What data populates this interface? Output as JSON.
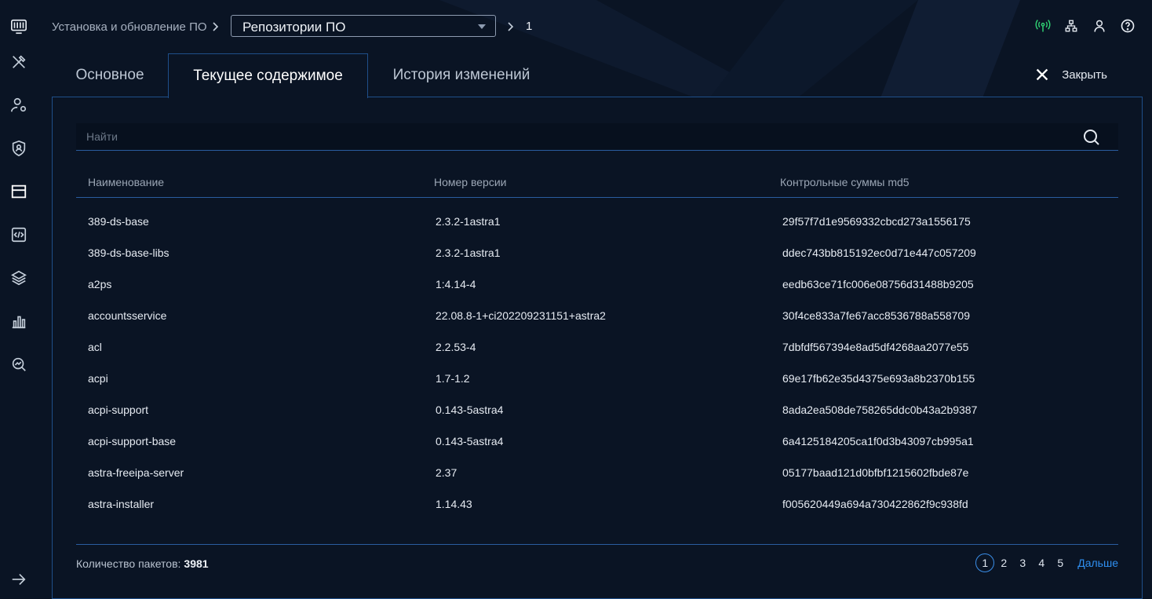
{
  "breadcrumb": {
    "root": "Установка и обновление ПО",
    "selected": "Репозитории ПО",
    "leaf": "1"
  },
  "tabs": [
    {
      "label": "Основное"
    },
    {
      "label": "Текущее содержимое"
    },
    {
      "label": "История изменений"
    }
  ],
  "active_tab": "Текущее содержимое",
  "close_label": "Закрыть",
  "search": {
    "placeholder": "Найти",
    "value": ""
  },
  "table": {
    "headers": [
      "Наименование",
      "Номер версии",
      "Контрольные суммы md5"
    ],
    "rows": [
      {
        "name": "389-ds-base",
        "version": "2.3.2-1astra1",
        "md5": "29f57f7d1e9569332cbcd273a1556175"
      },
      {
        "name": "389-ds-base-libs",
        "version": "2.3.2-1astra1",
        "md5": "ddec743bb815192ec0d71e447c057209"
      },
      {
        "name": "a2ps",
        "version": "1:4.14-4",
        "md5": "eedb63ce71fc006e08756d31488b9205"
      },
      {
        "name": "accountsservice",
        "version": "22.08.8-1+ci202209231151+astra2",
        "md5": "30f4ce833a7fe67acc8536788a558709"
      },
      {
        "name": "acl",
        "version": "2.2.53-4",
        "md5": "7dbfdf567394e8ad5df4268aa2077e55"
      },
      {
        "name": "acpi",
        "version": "1.7-1.2",
        "md5": "69e17fb62e35d4375e693a8b2370b155"
      },
      {
        "name": "acpi-support",
        "version": "0.143-5astra4",
        "md5": "8ada2ea508de758265ddc0b43a2b9387"
      },
      {
        "name": "acpi-support-base",
        "version": "0.143-5astra4",
        "md5": "6a4125184205ca1f0d3b43097cb995a1"
      },
      {
        "name": "astra-freeipa-server",
        "version": "2.37",
        "md5": "05177baad121d0bfbf1215602fbde87e"
      },
      {
        "name": "astra-installer",
        "version": "1.14.43",
        "md5": "f005620449a694a730422862f9c938fd"
      }
    ]
  },
  "footer": {
    "count_label": "Количество пакетов:",
    "count_value": "3981",
    "pages": [
      "1",
      "2",
      "3",
      "4",
      "5"
    ],
    "current_page": "1",
    "next_label": "Дальше"
  },
  "colors": {
    "background": "#0a1424",
    "border_accent": "#1f4f8a",
    "link": "#2f8ff0",
    "status_online": "#2ecc71"
  },
  "icons": {
    "sidebar": [
      "monitor-icon",
      "tools-icon",
      "user-settings-icon",
      "shield-user-icon",
      "window-icon",
      "code-file-icon",
      "layers-icon",
      "bar-chart-icon",
      "search-chart-icon",
      "arrow-right-icon"
    ],
    "topbar": [
      "antenna-icon",
      "network-icon",
      "user-icon",
      "help-icon"
    ]
  }
}
